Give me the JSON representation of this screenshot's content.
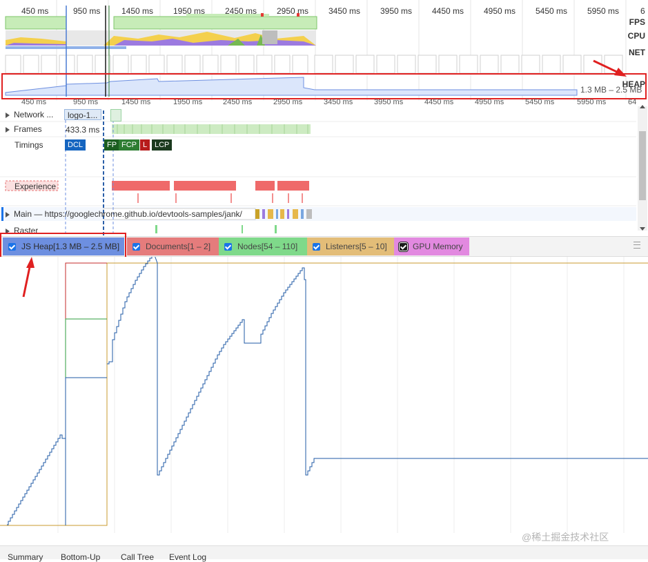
{
  "overview": {
    "ticks": [
      "450 ms",
      "950 ms",
      "1450 ms",
      "1950 ms",
      "2450 ms",
      "2950 ms",
      "3450 ms",
      "3950 ms",
      "4450 ms",
      "4950 ms",
      "5450 ms",
      "5950 ms",
      "6"
    ],
    "lanes": {
      "fps": "FPS",
      "cpu": "CPU",
      "net": "NET",
      "heap": "HEAP"
    },
    "heap_range": "1.3 MB – 2.5 MB"
  },
  "flame": {
    "ticks": [
      "450 ms",
      "950 ms",
      "1450 ms",
      "1950 ms",
      "2450 ms",
      "2950 ms",
      "3450 ms",
      "3950 ms",
      "4450 ms",
      "4950 ms",
      "5450 ms",
      "5950 ms",
      "64"
    ],
    "network_label": "Network ...",
    "network_item": "logo-1...",
    "frames_label": "Frames",
    "frames_value": "433.3 ms",
    "timings_label": "Timings",
    "markers": {
      "dcl": "DCL",
      "fp": "FP",
      "fcp": "FCP",
      "l": "L",
      "lcp": "LCP"
    },
    "experience_label": "Experience",
    "main_label": "Main — https://googlechrome.github.io/devtools-samples/jank/",
    "raster_label": "Raster"
  },
  "counters": [
    {
      "label": "JS Heap[1.3 MB – 2.5 MB]",
      "color": "#6d8fe0"
    },
    {
      "label": "Documents[1 – 2]",
      "color": "#e57c7c"
    },
    {
      "label": "Nodes[54 – 110]",
      "color": "#7fd98a"
    },
    {
      "label": "Listeners[5 – 10]",
      "color": "#e3bd78"
    },
    {
      "label": "GPU Memory",
      "color": "#e289e0"
    }
  ],
  "bottom_tabs": [
    "Summary",
    "Bottom-Up",
    "Call Tree",
    "Event Log"
  ],
  "watermark": "@稀土掘金技术社区",
  "colors": {
    "heap_line": "#1f5aa6",
    "docs_line": "#c62828",
    "nodes_line": "#2e9e3e",
    "listeners_line": "#c99a2e",
    "highlight": "#e02020"
  }
}
